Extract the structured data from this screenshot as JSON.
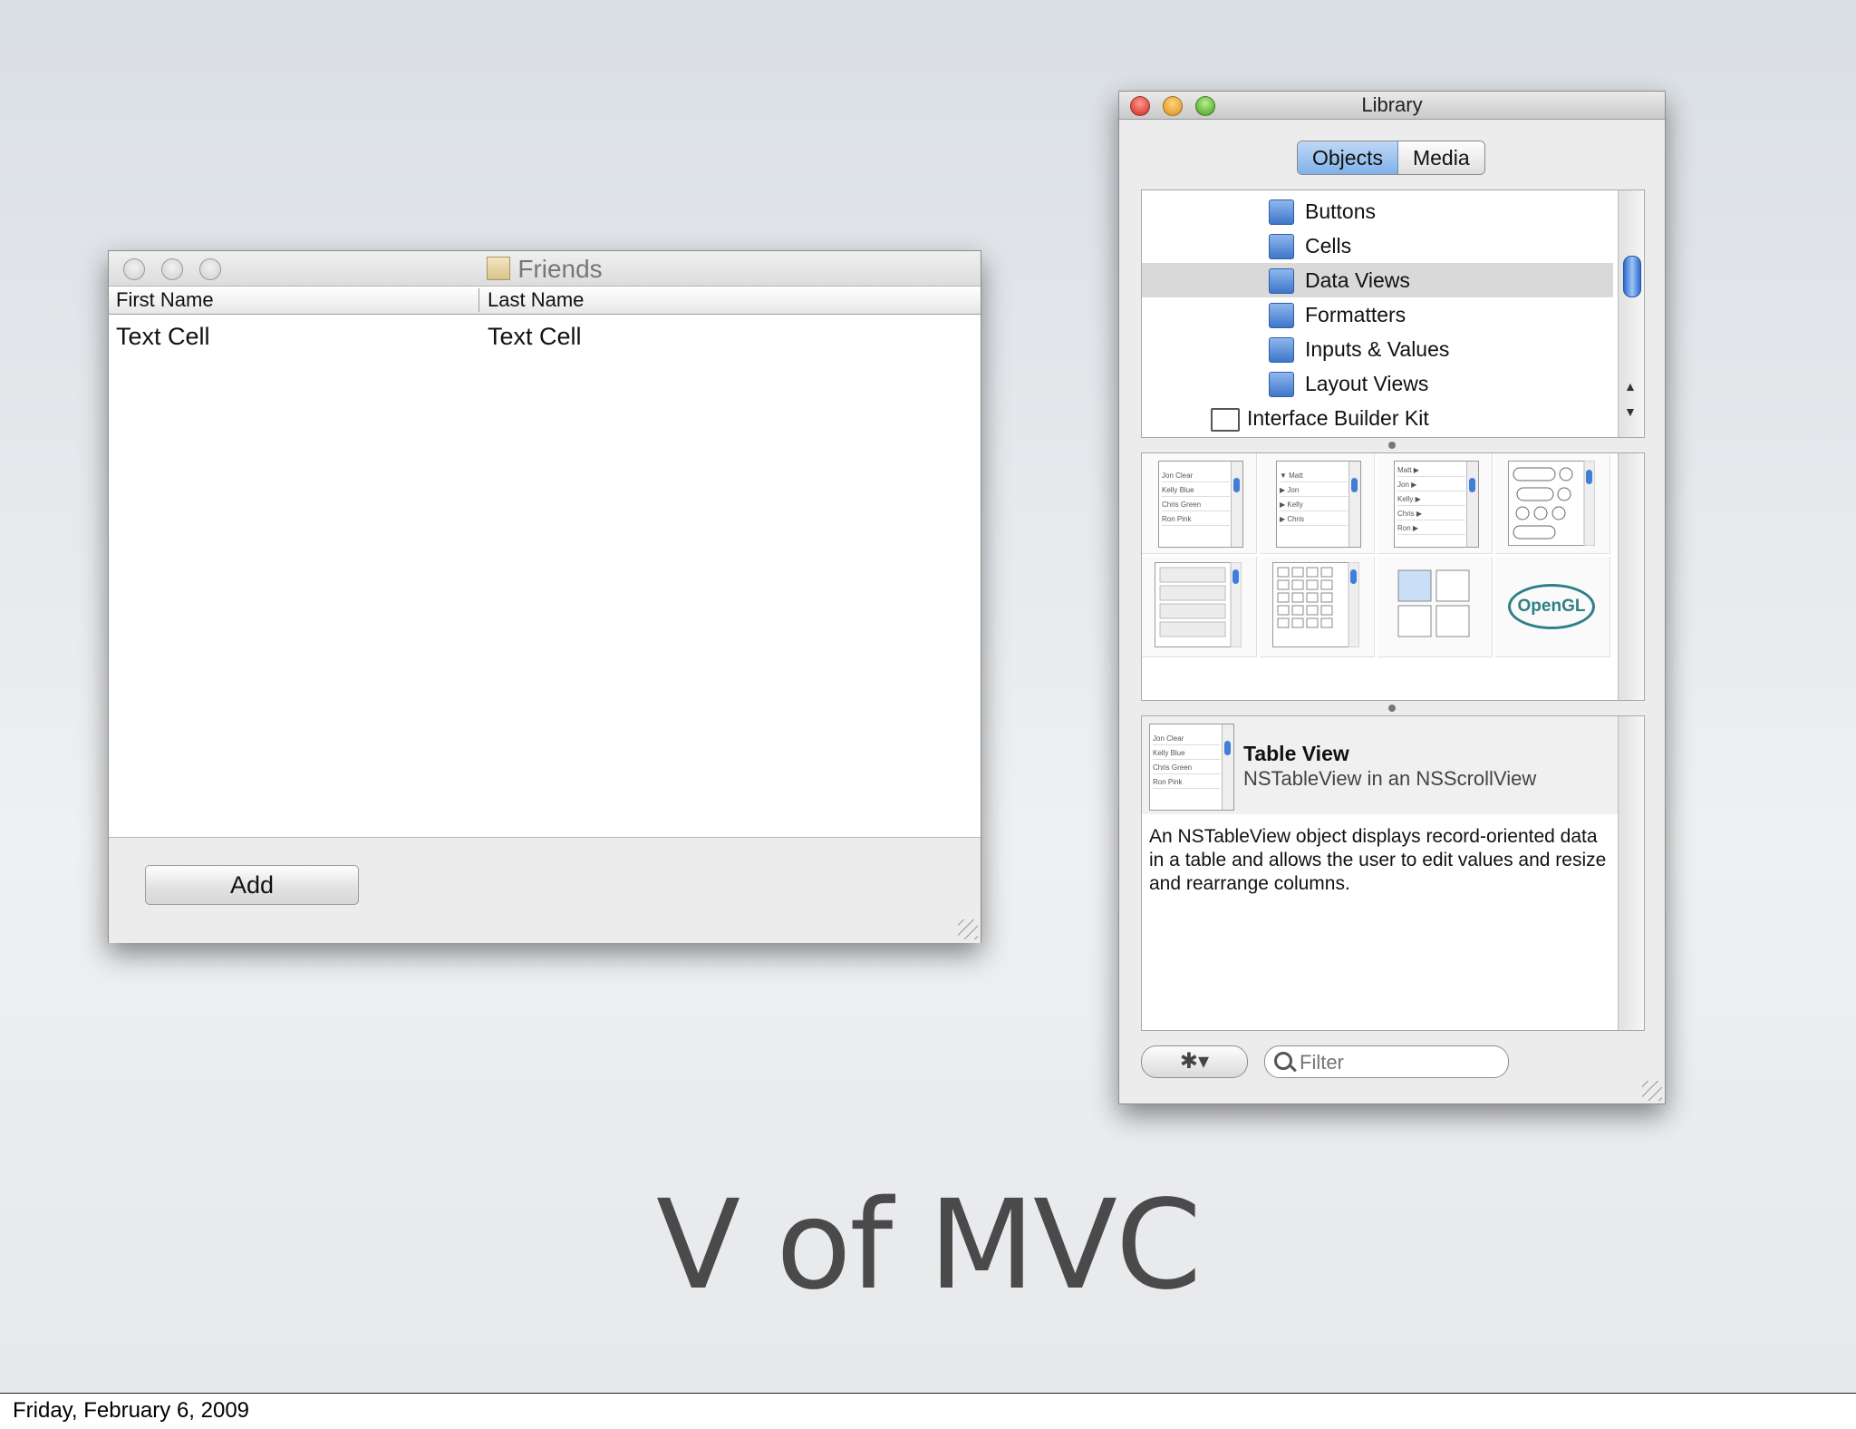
{
  "slide": {
    "title": "V of MVC",
    "footer_date": "Friday, February 6, 2009"
  },
  "friends_window": {
    "title": "Friends",
    "columns": [
      "First Name",
      "Last Name"
    ],
    "rows": [
      [
        "Text Cell",
        "Text Cell"
      ]
    ],
    "add_button": "Add"
  },
  "library_window": {
    "title": "Library",
    "segments": {
      "objects": "Objects",
      "media": "Media",
      "selected": "Objects"
    },
    "tree": [
      {
        "label": "Buttons",
        "icon": "blue-folder-icon"
      },
      {
        "label": "Cells",
        "icon": "blue-folder-icon"
      },
      {
        "label": "Data Views",
        "icon": "blue-folder-icon",
        "selected": true
      },
      {
        "label": "Formatters",
        "icon": "blue-folder-icon"
      },
      {
        "label": "Inputs & Values",
        "icon": "blue-folder-icon"
      },
      {
        "label": "Layout Views",
        "icon": "blue-folder-icon"
      },
      {
        "label": "Interface Builder Kit",
        "icon": "plain-folder-icon"
      }
    ],
    "tiles": [
      {
        "name": "table-view-tile",
        "rows": [
          "Jon   Clear",
          "Kelly  Blue",
          "Chris  Green",
          "Ron   Pink"
        ]
      },
      {
        "name": "outline-view-tile",
        "rows": [
          "▼ Matt",
          "  ▶ Jon",
          "  ▶ Kelly",
          "  ▶ Chris"
        ]
      },
      {
        "name": "browser-tile",
        "rows": [
          "Matt  ▶",
          "Jon   ▶",
          "Kelly  ▶",
          "Chris  ▶",
          "Ron  ▶"
        ]
      },
      {
        "name": "collection-view-tile",
        "rows": []
      },
      {
        "name": "scroll-view-tile",
        "rows": []
      },
      {
        "name": "matrix-tile",
        "rows": []
      },
      {
        "name": "split-view-tile",
        "rows": []
      },
      {
        "name": "opengl-view-tile",
        "label": "OpenGL"
      }
    ],
    "detail": {
      "title": "Table View",
      "subtitle": "NSTableView in an NSScrollView",
      "description": "An NSTableView object displays record-oriented data in a table and allows the user to edit values and resize and rearrange columns."
    },
    "filter_placeholder": "Filter",
    "gear_label": "✱▾"
  }
}
